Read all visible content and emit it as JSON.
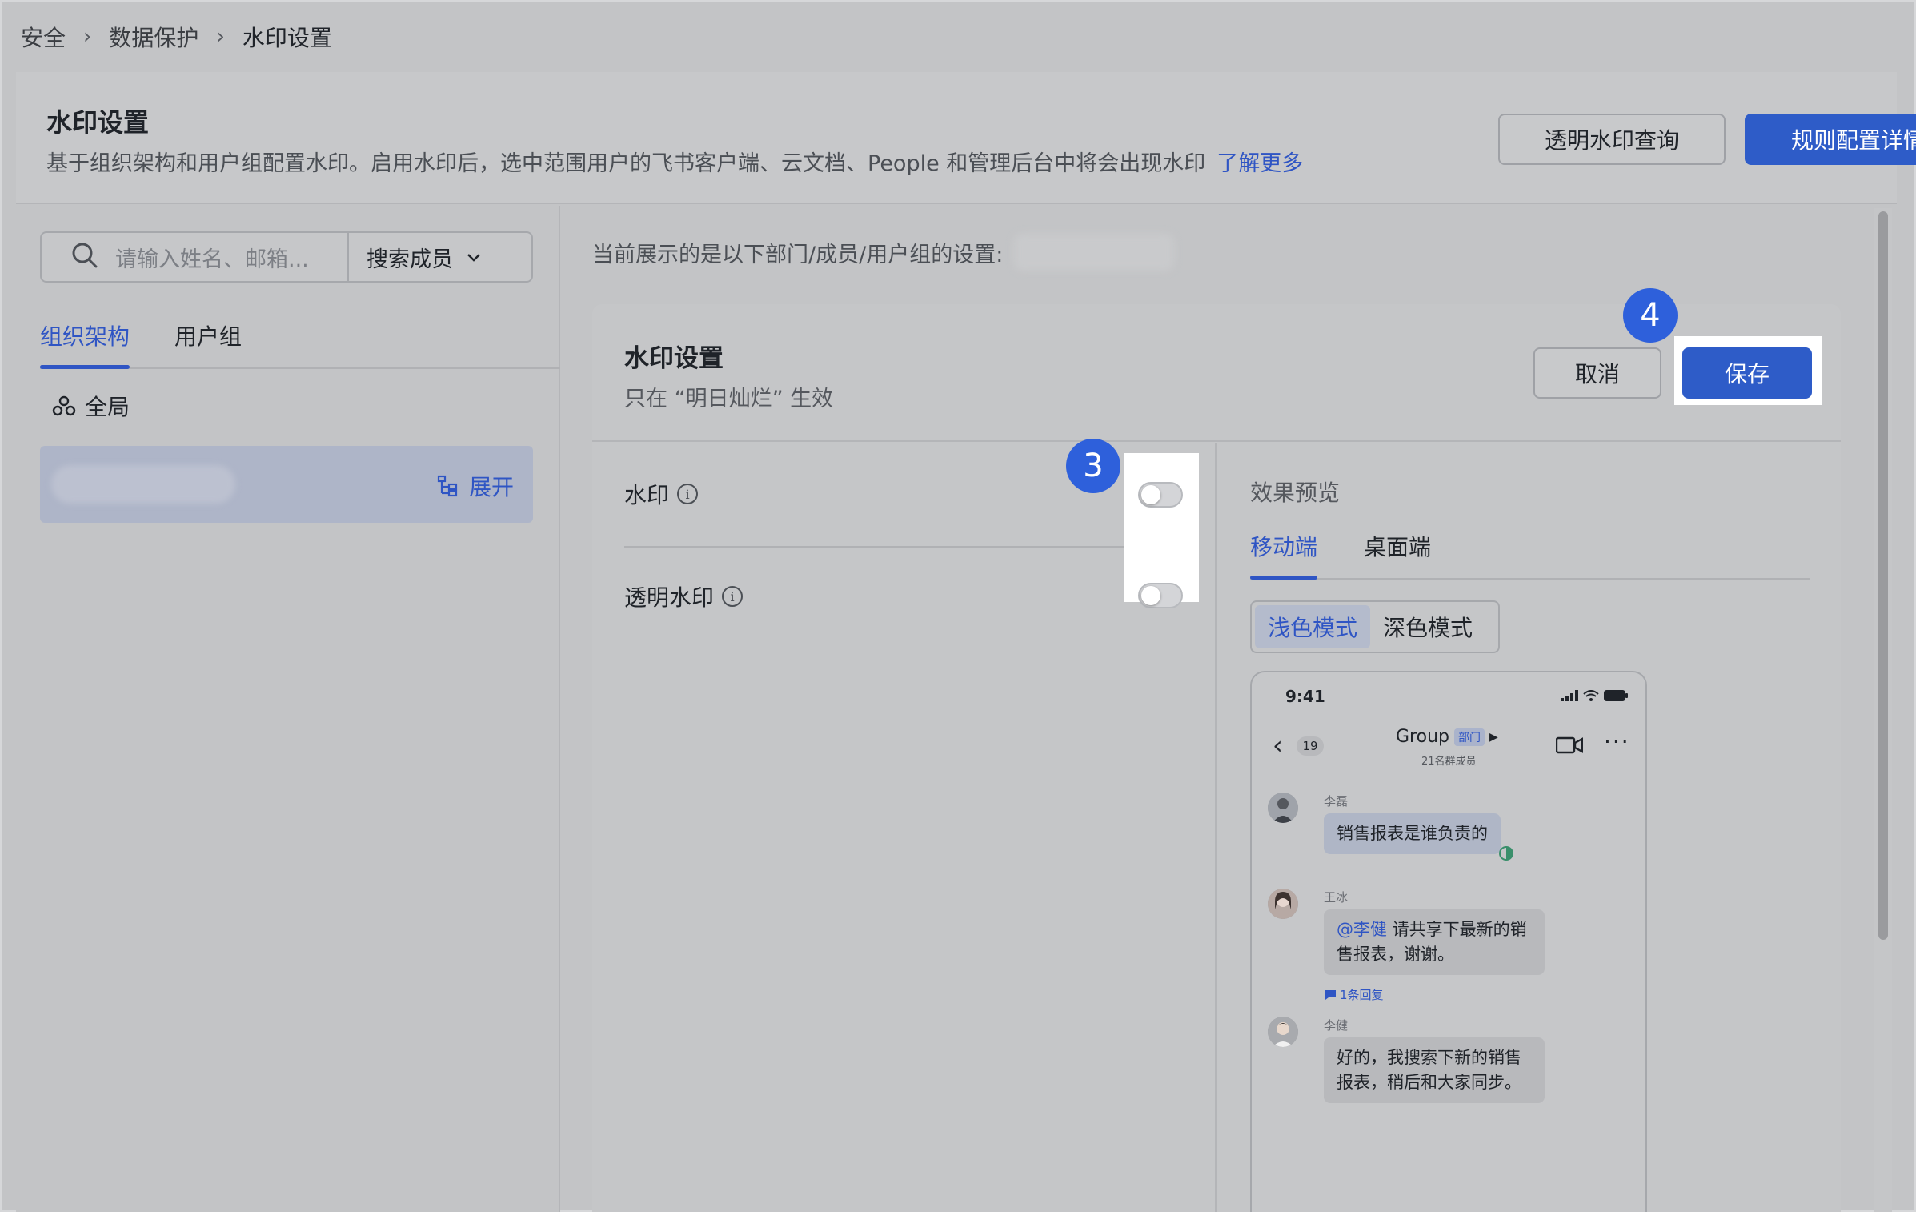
{
  "breadcrumb": [
    "安全",
    "数据保护",
    "水印设置"
  ],
  "header": {
    "title": "水印设置",
    "description": "基于组织架构和用户组配置水印。启用水印后，选中范围用户的飞书客户端、云文档、People 和管理后台中将会出现水印",
    "learn_more": "了解更多",
    "btn_query": "透明水印查询",
    "btn_rules": "规则配置详情"
  },
  "left": {
    "search_placeholder": "请输入姓名、邮箱...",
    "search_scope": "搜索成员",
    "tabs": [
      "组织架构",
      "用户组"
    ],
    "global_label": "全局",
    "expand_label": "展开"
  },
  "right": {
    "current_scope_label": "当前展示的是以下部门/成员/用户组的设置:",
    "panel_title": "水印设置",
    "panel_sub": "只在 “明日灿烂” 生效",
    "btn_cancel": "取消",
    "btn_save": "保存",
    "settings": [
      {
        "label": "水印",
        "enabled": false
      },
      {
        "label": "透明水印",
        "enabled": false
      }
    ],
    "badges": {
      "step3": "3",
      "step4": "4"
    }
  },
  "preview": {
    "label": "效果预览",
    "tabs": [
      "移动端",
      "桌面端"
    ],
    "modes": [
      "浅色模式",
      "深色模式"
    ],
    "phone": {
      "time": "9:41",
      "unread": "19",
      "group_name": "Group",
      "group_tag": "部门",
      "members": "21名群成员",
      "messages": [
        {
          "sender": "李磊",
          "text": "销售报表是谁负责的"
        },
        {
          "sender": "王冰",
          "mention": "@李健",
          "text": " 请共享下最新的销售报表，谢谢。",
          "reply": "1条回复"
        },
        {
          "sender": "李健",
          "text": "好的，我搜索下新的销售报表，稍后和大家同步。"
        }
      ]
    }
  },
  "colors": {
    "accent": "#2f55c4",
    "primary_button": "#2e5cc8",
    "badge": "#2e60db"
  }
}
